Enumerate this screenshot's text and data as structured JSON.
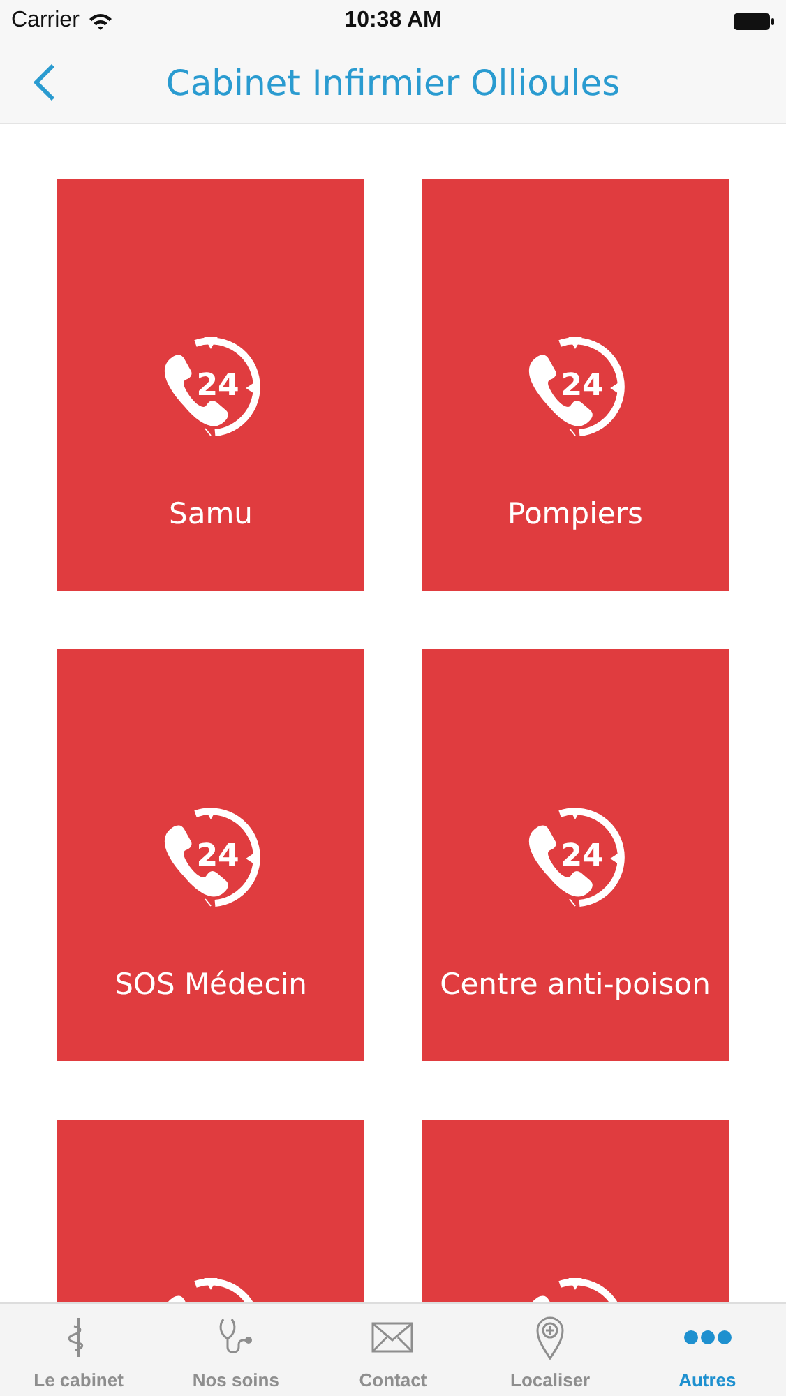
{
  "status_bar": {
    "carrier": "Carrier",
    "time": "10:38 AM"
  },
  "nav_bar": {
    "title": "Cabinet Infirmier Ollioules"
  },
  "tiles": [
    {
      "kind": "full",
      "label": "Samu",
      "icon_text": "24"
    },
    {
      "kind": "full",
      "label": "Pompiers",
      "icon_text": "24"
    },
    {
      "kind": "full",
      "label": "SOS Médecin",
      "icon_text": "24"
    },
    {
      "kind": "full",
      "label": "Centre anti-poison",
      "icon_text": "24"
    },
    {
      "kind": "cut"
    },
    {
      "kind": "cut"
    }
  ],
  "tab_bar": [
    {
      "label": "Le cabinet",
      "kind": "staff",
      "selected": false
    },
    {
      "label": "Nos soins",
      "kind": "stethoscope",
      "selected": false
    },
    {
      "label": "Contact",
      "kind": "mail",
      "selected": false
    },
    {
      "label": "Localiser",
      "kind": "pin",
      "selected": false
    },
    {
      "label": "Autres",
      "kind": "more",
      "selected": true
    }
  ]
}
